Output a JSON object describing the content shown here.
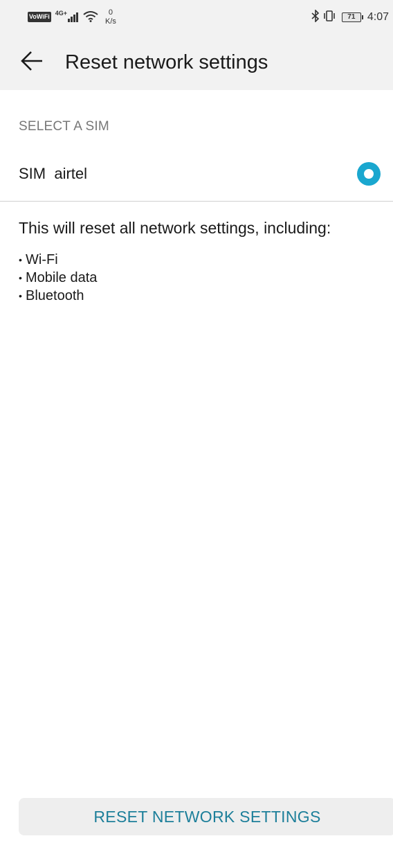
{
  "status_bar": {
    "vowifi": "VoWiFi",
    "network_type": "4G+",
    "speed_value": "0",
    "speed_unit": "K/s",
    "battery_level": "71",
    "time": "4:07"
  },
  "toolbar": {
    "back_icon": "arrow-back-icon",
    "title": "Reset network settings"
  },
  "sim_section": {
    "header": "SELECT A SIM",
    "sim_label": "SIM  airtel",
    "selected": true,
    "accent_color": "#1aa7cf"
  },
  "description": {
    "intro": "This will reset all network settings, including:",
    "items": [
      {
        "label": "Wi-Fi"
      },
      {
        "label": "Mobile data"
      },
      {
        "label": "Bluetooth"
      }
    ]
  },
  "footer": {
    "reset_button_label": "RESET NETWORK SETTINGS",
    "button_text_color": "#1d7f9a"
  }
}
